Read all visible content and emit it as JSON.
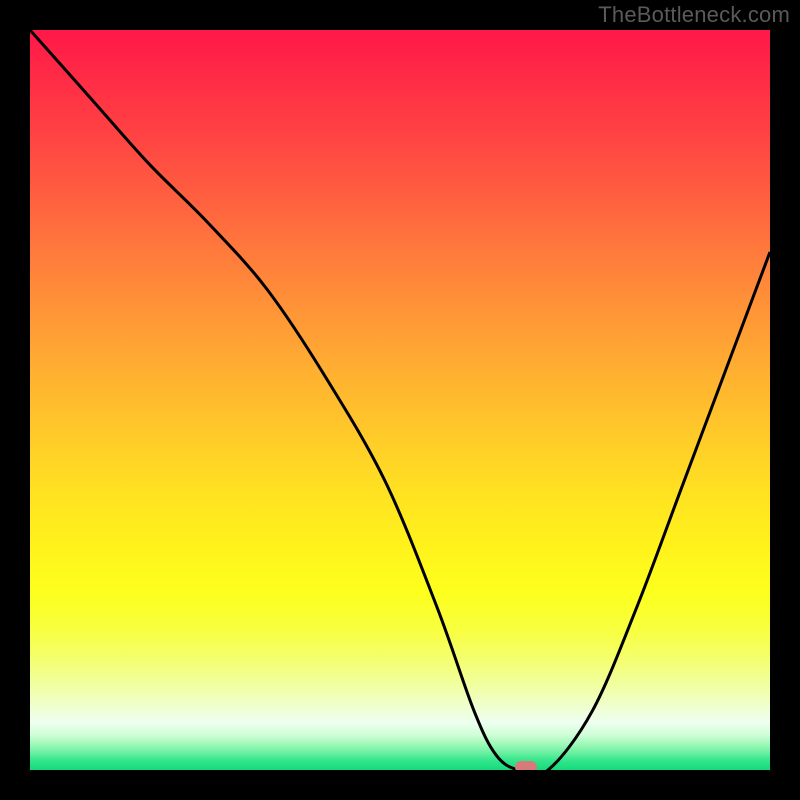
{
  "watermark": "TheBottleneck.com",
  "chart_data": {
    "type": "line",
    "title": "",
    "xlabel": "",
    "ylabel": "",
    "xlim": [
      0,
      100
    ],
    "ylim": [
      0,
      100
    ],
    "grid": false,
    "legend": false,
    "series": [
      {
        "name": "bottleneck-curve",
        "x": [
          0,
          8,
          16,
          24,
          32,
          40,
          48,
          55,
          60,
          63,
          66,
          70,
          76,
          82,
          88,
          94,
          100
        ],
        "y": [
          100,
          91,
          82,
          74,
          65,
          53,
          39,
          22,
          8,
          2,
          0,
          0,
          8,
          22,
          38,
          54,
          70
        ]
      }
    ],
    "marker": {
      "x": 67,
      "y": 0,
      "color": "#d77a7a"
    },
    "background_gradient": {
      "top": "#ff1848",
      "mid": "#ffe022",
      "bottom": "#14db7c"
    }
  }
}
